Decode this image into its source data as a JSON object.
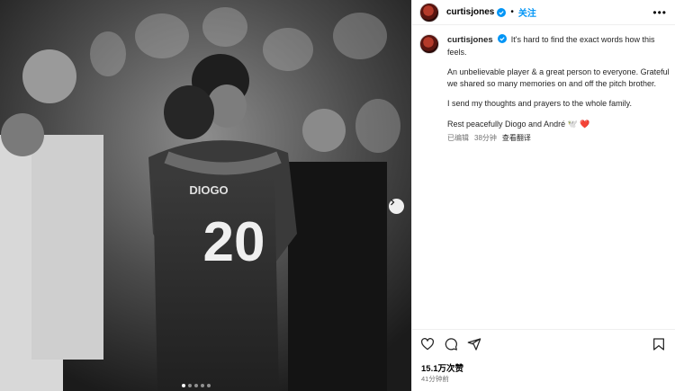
{
  "post": {
    "username": "curtisjones",
    "follow_label": "关注",
    "separator": "•",
    "more_label": "•••",
    "caption_first": "It's hard to find the exact words how this feels.",
    "caption_p2": "An unbelievable player & a great person to everyone. Grateful we shared so many memories on and off the pitch brother.",
    "caption_p3": "I send my thoughts and prayers to the whole family.",
    "caption_p4": "Rest peacefully Diogo and André 🕊️ ❤️",
    "edited_label": "已编辑",
    "edited_time": "38分钟",
    "see_translation": "查看翻译",
    "likes": "15.1万次赞",
    "posted_time": "41分钟前"
  },
  "photo": {
    "shirt_number": "20",
    "shirt_name": "DIOGO",
    "carousel": {
      "count": 5,
      "active_index": 1
    }
  },
  "icons": {
    "verified": "verified-badge-icon",
    "like": "heart-icon",
    "comment": "comment-icon",
    "share": "share-icon",
    "save": "bookmark-icon",
    "next": "chevron-right-icon"
  },
  "colors": {
    "accent": "#0095f6",
    "verified": "#0095f6",
    "muted": "#737373"
  }
}
